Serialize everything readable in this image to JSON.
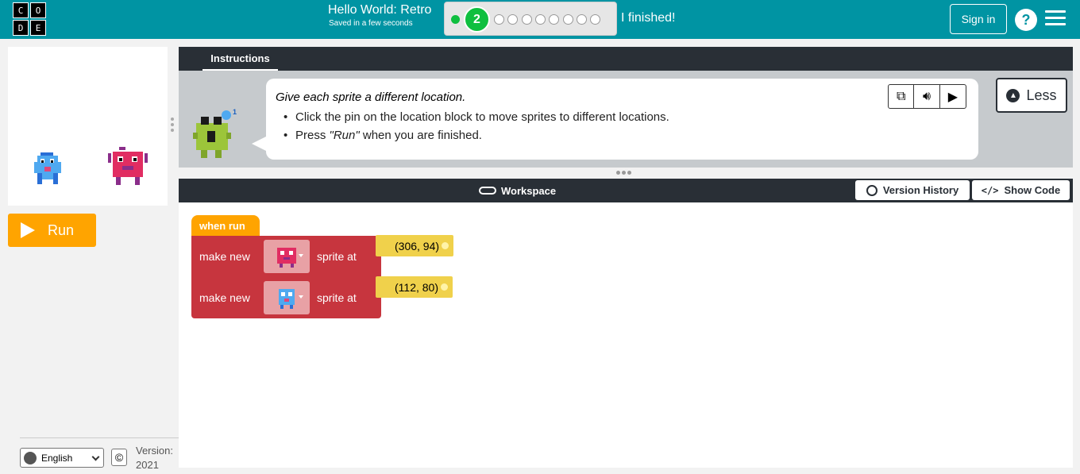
{
  "header": {
    "logo_letters": [
      "C",
      "O",
      "D",
      "E"
    ],
    "project_title": "Hello World: Retro",
    "saved_status": "Saved in a few seconds",
    "progress": {
      "current_level": "2",
      "total_dots": 10,
      "completed_dots": 1
    },
    "finished_label": "I finished!",
    "sign_in_label": "Sign in",
    "help_label": "?"
  },
  "left": {
    "run_label": "Run",
    "language": "English",
    "copyright_symbol": "©",
    "version_label": "Version:",
    "version_value": "2021"
  },
  "instructions": {
    "tab_label": "Instructions",
    "main_text": "Give each sprite a different location.",
    "steps": [
      "Click the pin on the location block to move sprites to different locations.",
      "Press \"Run\" when you are finished."
    ],
    "avatar_badge": "1",
    "less_label": "Less"
  },
  "workspace": {
    "title": "Workspace",
    "version_history_label": "Version History",
    "show_code_label": "Show Code",
    "blocks": {
      "hat_label": "when run",
      "rows": [
        {
          "prefix": "make new",
          "sprite": "pink-alien",
          "suffix": "sprite at",
          "coord": "(306, 94)"
        },
        {
          "prefix": "make new",
          "sprite": "blue-alien",
          "suffix": "sprite at",
          "coord": "(112, 80)"
        }
      ]
    }
  },
  "colors": {
    "header": "#0094a3",
    "run": "#ffa400",
    "block_red": "#c7353e",
    "block_yellow": "#f0d14b",
    "dark_bar": "#292f36"
  }
}
